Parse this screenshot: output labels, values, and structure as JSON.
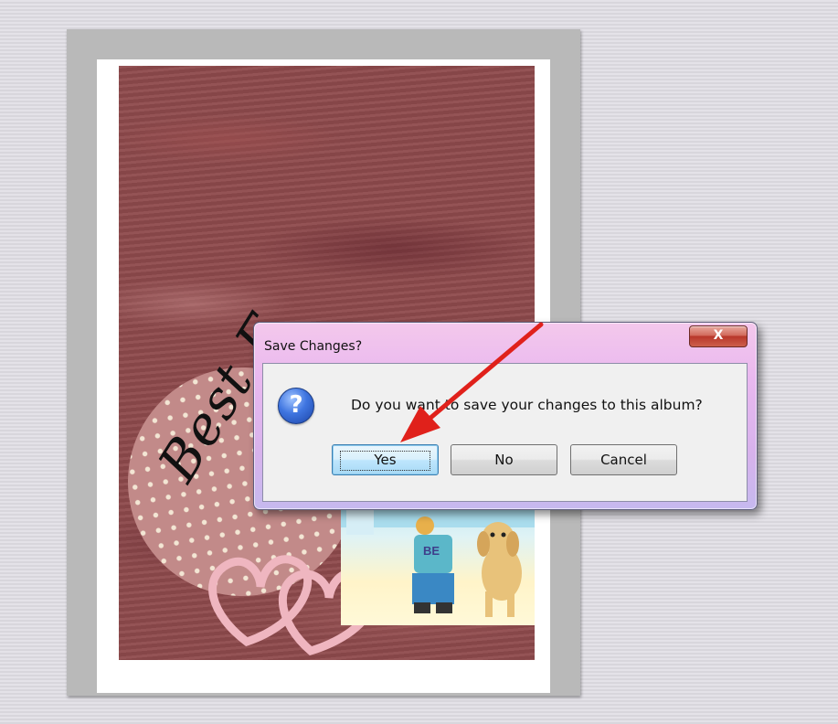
{
  "dialog": {
    "title": "Save Changes?",
    "close_label": "X",
    "message": "Do you want to save your changes to this album?",
    "icon": "question-icon",
    "buttons": {
      "yes": "Yes",
      "no": "No",
      "cancel": "Cancel"
    }
  },
  "scrapbook": {
    "text_fragment": "Best F"
  },
  "colors": {
    "annotation_arrow": "#e0211b",
    "page_background": "#8e4a4c"
  }
}
